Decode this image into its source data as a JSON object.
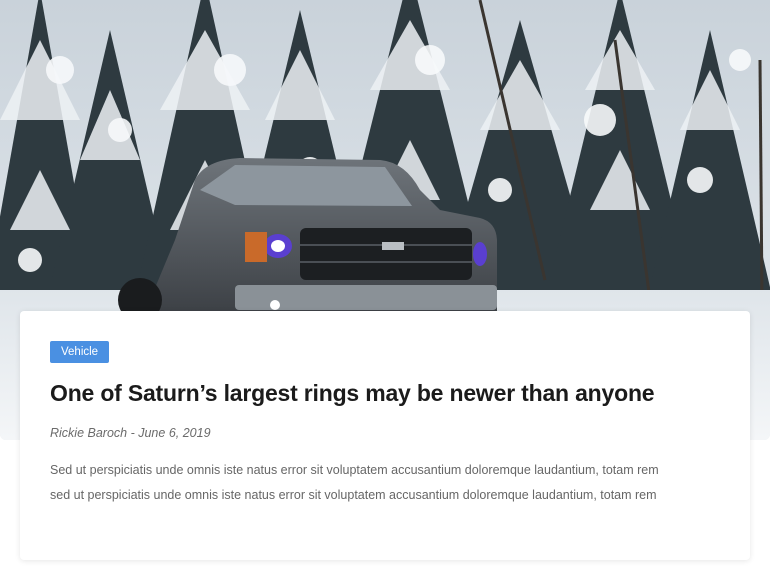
{
  "post": {
    "category": "Vehicle",
    "title": "One of Saturn’s largest rings may be newer than anyone",
    "author": "Rickie Baroch",
    "date_separator": " - ",
    "date": "June 6, 2019",
    "excerpt": "Sed ut perspiciatis unde omnis iste natus error sit voluptatem accusantium doloremque laudantium, totam rem sed ut perspiciatis unde omnis iste natus error sit voluptatem accusantium doloremque laudantium, totam rem"
  },
  "colors": {
    "tag_background": "#4a90e2",
    "title": "#1b1b1b",
    "body_text": "#666666"
  },
  "image": {
    "subject": "grey pickup truck in snowy pine forest"
  }
}
